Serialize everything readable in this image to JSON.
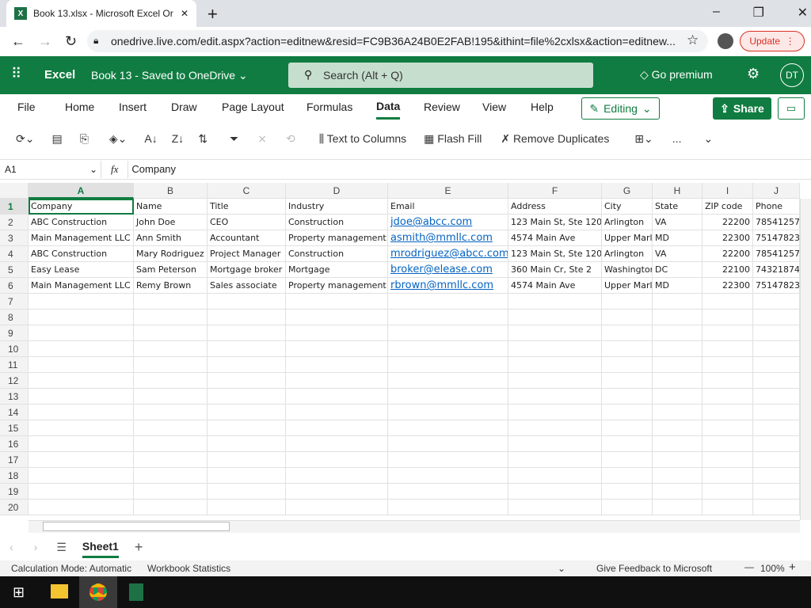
{
  "browser": {
    "tab_title": "Book 13.xlsx - Microsoft Excel Or",
    "url": "onedrive.live.com/edit.aspx?action=editnew&resid=FC9B36A24B0E2FAB!195&ithint=file%2cxlsx&action=editnew...",
    "update_label": "Update"
  },
  "app": {
    "name": "Excel",
    "doc_title": "Book 13 - Saved to OneDrive",
    "search_placeholder": "Search (Alt + Q)",
    "premium": "Go premium",
    "avatar": "DT"
  },
  "menu": [
    "File",
    "Home",
    "Insert",
    "Draw",
    "Page Layout",
    "Formulas",
    "Data",
    "Review",
    "View",
    "Help"
  ],
  "active_menu": "Data",
  "editing": "Editing",
  "share": "Share",
  "toolbar": {
    "text_to_columns": "Text to Columns",
    "flash_fill": "Flash Fill",
    "remove_duplicates": "Remove Duplicates",
    "more": "..."
  },
  "formula_bar": {
    "name_box": "A1",
    "fx": "fx",
    "value": "Company"
  },
  "columns": [
    "A",
    "B",
    "C",
    "D",
    "E",
    "F",
    "G",
    "H",
    "I",
    "J"
  ],
  "rows": [
    [
      "Company",
      "Name",
      "Title",
      "Industry",
      "Email",
      "Address",
      "City",
      "State",
      "ZIP code",
      "Phone"
    ],
    [
      "ABC Construction",
      "John Doe",
      "CEO",
      "Construction",
      "jdoe@abcc.com",
      "123 Main St, Ste 120",
      "Arlington",
      "VA",
      "22200",
      "78541257"
    ],
    [
      "Main Management LLC",
      "Ann Smith",
      "Accountant",
      "Property management",
      "asmith@mmllc.com",
      "4574 Main Ave",
      "Upper Marlboro",
      "MD",
      "22300",
      "75147823"
    ],
    [
      "ABC Construction",
      "Mary Rodriguez",
      "Project Manager",
      "Construction",
      "mrodriguez@abcc.com",
      "123 Main St, Ste 120",
      "Arlington",
      "VA",
      "22200",
      "78541257"
    ],
    [
      "Easy Lease",
      "Sam Peterson",
      "Mortgage broker",
      "Mortgage",
      "broker@elease.com",
      "360 Main Cr, Ste 2",
      "Washington",
      "DC",
      "22100",
      "74321874"
    ],
    [
      "Main Management LLC",
      "Remy Brown",
      "Sales associate",
      "Property management",
      "rbrown@mmllc.com",
      "4574 Main Ave",
      "Upper Marlboro",
      "MD",
      "22300",
      "75147823"
    ]
  ],
  "row_numbers": [
    "1",
    "2",
    "3",
    "4",
    "5",
    "6",
    "7",
    "8",
    "9",
    "10",
    "11",
    "12",
    "13",
    "14",
    "15",
    "16",
    "17",
    "18",
    "19",
    "20"
  ],
  "sheet": "Sheet1",
  "status": {
    "calc": "Calculation Mode: Automatic",
    "stats": "Workbook Statistics",
    "feedback": "Give Feedback to Microsoft",
    "zoom": "100%"
  },
  "colors": {
    "brand": "#107c41",
    "link": "#0563c1"
  }
}
